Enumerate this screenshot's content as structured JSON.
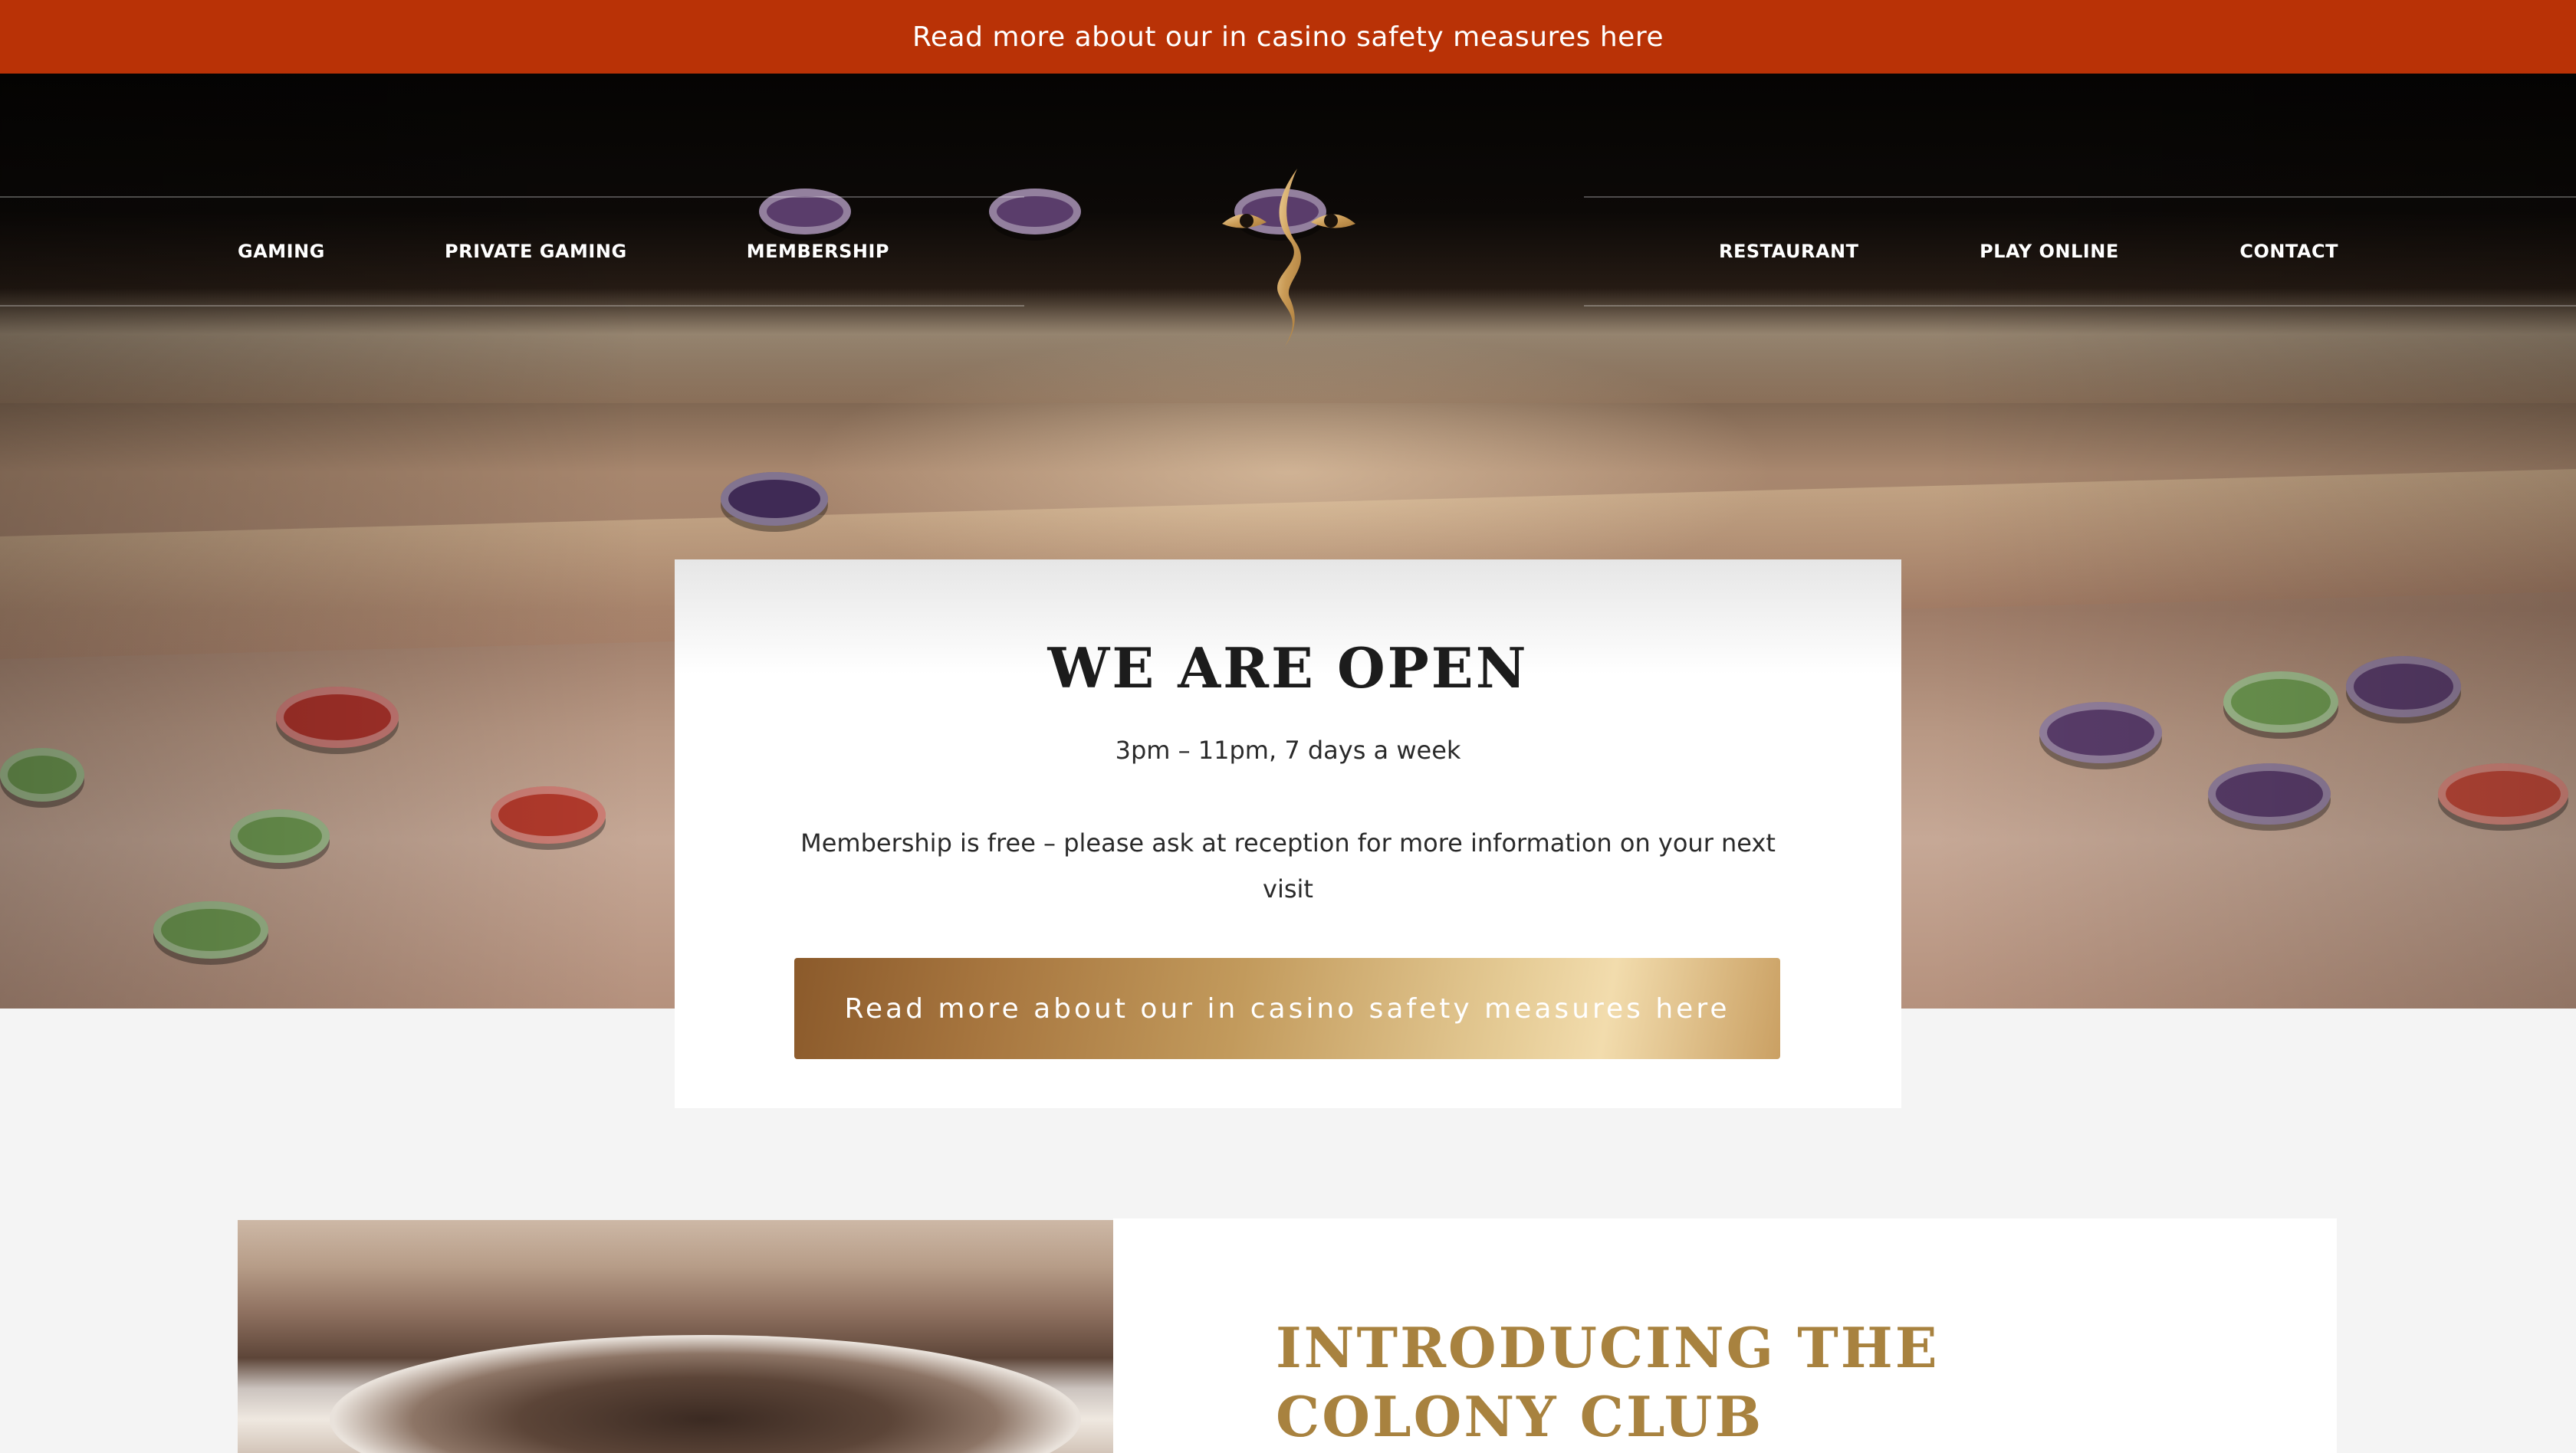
{
  "announcement": {
    "text": "Read more about our in casino safety measures here"
  },
  "nav": {
    "left": [
      {
        "label": "GAMING"
      },
      {
        "label": "PRIVATE GAMING"
      },
      {
        "label": "MEMBERSHIP"
      }
    ],
    "right": [
      {
        "label": "RESTAURANT"
      },
      {
        "label": "PLAY ONLINE"
      },
      {
        "label": "CONTACT"
      }
    ]
  },
  "open_card": {
    "title": "WE ARE OPEN",
    "hours": "3pm – 11pm, 7 days a week",
    "membership": "Membership is free – please ask at reception for more information on your next visit",
    "button_label": "Read more about our in casino safety measures here"
  },
  "intro": {
    "title": "INTRODUCING THE COLONY CLUB"
  },
  "colors": {
    "announcement_bg": "#b93206",
    "gold_accent": "#a8823f",
    "page_bg": "#f4f4f4"
  }
}
